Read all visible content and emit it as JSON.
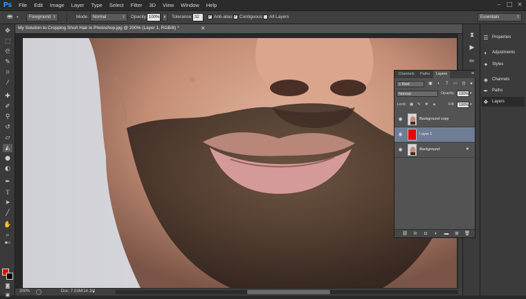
{
  "app": {
    "logo": "Ps",
    "accent_color": "#3aa3ff"
  },
  "menubar": {
    "items": [
      "File",
      "Edit",
      "Image",
      "Layer",
      "Type",
      "Select",
      "Filter",
      "3D",
      "View",
      "Window",
      "Help"
    ],
    "window_controls": [
      "minimize-icon",
      "maximize-icon",
      "close-icon"
    ]
  },
  "options_bar": {
    "tool_icon": "paint-bucket-icon",
    "source_value": "Foreground",
    "mode_label": "Mode:",
    "mode_value": "Normal",
    "opacity_label": "Opacity:",
    "opacity_value": "100%",
    "tolerance_label": "Tolerance:",
    "tolerance_value": "32",
    "anti_alias_label": "Anti-alias",
    "anti_alias_checked": true,
    "contiguous_label": "Contiguous",
    "contiguous_checked": true,
    "all_layers_label": "All Layers",
    "all_layers_checked": false,
    "workspace_value": "Essentials"
  },
  "toolbar": {
    "tools": [
      "move-icon",
      "marquee-icon",
      "lasso-icon",
      "quick-select-icon",
      "crop-icon",
      "eyedropper-icon",
      "healing-brush-icon",
      "brush-icon",
      "clone-stamp-icon",
      "history-brush-icon",
      "eraser-icon",
      "paint-bucket-icon",
      "blur-icon",
      "dodge-icon",
      "pen-icon",
      "type-icon",
      "path-select-icon",
      "line-icon",
      "hand-icon",
      "zoom-icon"
    ],
    "foreground_color": "#ee0000",
    "background_color": "#000000"
  },
  "document": {
    "tab_title": "My Solution to Cropping Short Hair in Photoshop.jpg @ 200% (Layer 1, RGB/8) *",
    "close_glyph": "×"
  },
  "status": {
    "zoom": "200%",
    "doc_info": "Doc: 7.03M/14.1M",
    "arrow_glyph": "▸"
  },
  "right_panels": {
    "items": [
      {
        "icon": "properties-icon",
        "label": "Properties"
      },
      {
        "icon": "adjustments-icon",
        "label": "Adjustments"
      },
      {
        "icon": "styles-icon",
        "label": "Styles"
      },
      {
        "icon": "channels-icon",
        "label": "Channels"
      },
      {
        "icon": "paths-icon",
        "label": "Paths"
      },
      {
        "icon": "layers-icon",
        "label": "Layers"
      }
    ],
    "active": "Layers"
  },
  "layers_panel": {
    "tabs": [
      "Channels",
      "Paths",
      "Layers"
    ],
    "active_tab": "Layers",
    "filter_value": "Kind",
    "blend_mode": "Normal",
    "opacity_label": "Opacity:",
    "opacity_value": "100%",
    "lock_label": "Lock:",
    "fill_label": "Fill:",
    "fill_value": "100%",
    "layers": [
      {
        "name": "Background copy",
        "selected": false,
        "thumb": "photo",
        "locked": false
      },
      {
        "name": "Layer 1",
        "selected": true,
        "thumb": "red",
        "locked": false
      },
      {
        "name": "Background",
        "selected": false,
        "thumb": "photo",
        "locked": true
      }
    ],
    "thumb_red_color": "#ee0000",
    "footer_labels": [
      "link-icon",
      "fx",
      "mask-icon",
      "adjustment-layer-icon",
      "group-icon",
      "new-layer-icon",
      "trash-icon"
    ],
    "fx_label": "fx"
  }
}
